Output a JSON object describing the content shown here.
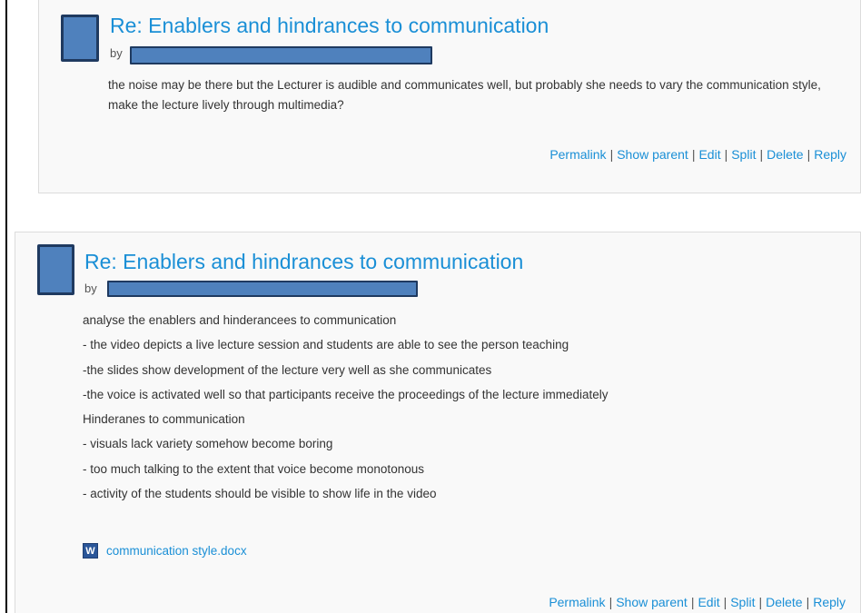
{
  "posts": [
    {
      "subject": "Re: Enablers and hindrances to communication",
      "by_label": "by",
      "body": "the noise may be there but the Lecturer is audible and communicates well, but probably she needs to vary the communication style, make the lecture lively through multimedia?",
      "commands": {
        "permalink": "Permalink",
        "show_parent": "Show parent",
        "edit": "Edit",
        "split": "Split",
        "delete": "Delete",
        "reply": "Reply"
      }
    },
    {
      "subject": "Re: Enablers and hindrances to communication",
      "by_label": "by",
      "body_lines": [
        "analyse the enablers and hinderancees to communication",
        "- the video depicts a live lecture session and students are  able to see the person teaching",
        "-the slides show development of the lecture very well as she communicates",
        "-the voice is activated well so that participants receive the proceedings of the lecture immediately",
        "Hinderanes to communication",
        "- visuals lack variety somehow become boring",
        "- too much talking to the extent that voice become monotonous",
        "- activity of the students should be visible to show life in the video"
      ],
      "attachment": {
        "filename": "communication style.docx",
        "icon": "word-document-icon",
        "icon_glyph": "W"
      },
      "commands": {
        "permalink": "Permalink",
        "show_parent": "Show parent",
        "edit": "Edit",
        "split": "Split",
        "delete": "Delete",
        "reply": "Reply"
      }
    }
  ],
  "separator": "|",
  "colors": {
    "link": "#1a8fd6",
    "redaction_fill": "#4f81bd",
    "redaction_border": "#1f3a60",
    "post_background": "#f9f9f9"
  }
}
